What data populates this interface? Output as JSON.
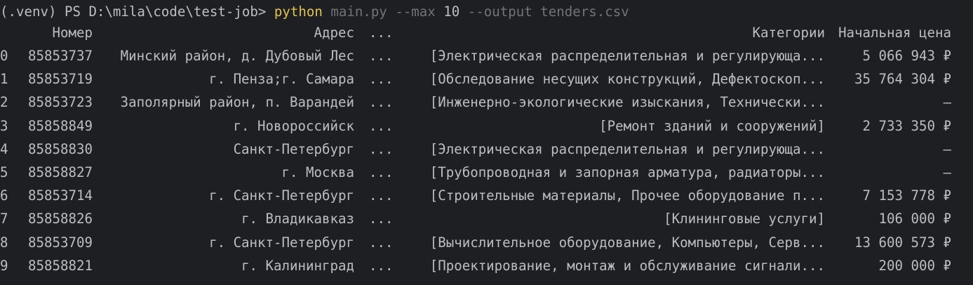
{
  "prompt": {
    "prefix": "(.venv) PS D:\\mila\\code\\test-job> ",
    "command": "python",
    "script": " main.py ",
    "flag_max": "--max",
    "max_value": " 10 ",
    "flag_output": "--output",
    "output_value": " tenders.csv"
  },
  "table": {
    "headers": {
      "number": "Номер",
      "address": "Адрес",
      "ellipsis": "...",
      "categories": "Категории",
      "price": "Начальная цена"
    },
    "rows": [
      {
        "idx": "0",
        "number": "85853737",
        "address": "Минский район, д. Дубовый Лес",
        "ellipsis": "...",
        "categories": "[Электрическая распределительная и регулирующа...",
        "price": "5 066 943 ₽"
      },
      {
        "idx": "1",
        "number": "85853719",
        "address": "г. Пенза;г. Самара",
        "ellipsis": "...",
        "categories": "[Обследование несущих конструкций, Дефектоскоп...",
        "price": "35 764 304 ₽"
      },
      {
        "idx": "2",
        "number": "85853723",
        "address": "Заполярный район, п. Варандей",
        "ellipsis": "...",
        "categories": "[Инженерно-экологические изыскания, Технически...",
        "price": "—"
      },
      {
        "idx": "3",
        "number": "85858849",
        "address": "г. Новороссийск",
        "ellipsis": "...",
        "categories": "[Ремонт зданий и сооружений]",
        "price": "2 733 350 ₽"
      },
      {
        "idx": "4",
        "number": "85858830",
        "address": "Санкт-Петербург",
        "ellipsis": "...",
        "categories": "[Электрическая распределительная и регулирующа...",
        "price": "—"
      },
      {
        "idx": "5",
        "number": "85858827",
        "address": "г. Москва",
        "ellipsis": "...",
        "categories": "[Трубопроводная и запорная арматура, радиаторы...",
        "price": "—"
      },
      {
        "idx": "6",
        "number": "85853714",
        "address": "г. Санкт-Петербург",
        "ellipsis": "...",
        "categories": "[Строительные материалы, Прочее оборудование п...",
        "price": "7 153 778 ₽"
      },
      {
        "idx": "7",
        "number": "85858826",
        "address": "г. Владикавказ",
        "ellipsis": "...",
        "categories": "[Клининговые услуги]",
        "price": "106 000 ₽"
      },
      {
        "idx": "8",
        "number": "85853709",
        "address": "г. Санкт-Петербург",
        "ellipsis": "...",
        "categories": "[Вычислительное оборудование, Компьютеры, Серв...",
        "price": "13 600 573 ₽"
      },
      {
        "idx": "9",
        "number": "85858821",
        "address": "г. Калининград",
        "ellipsis": "...",
        "categories": "[Проектирование, монтаж и обслуживание сигнали...",
        "price": "200 000 ₽"
      }
    ]
  },
  "colors": {
    "background": "#1e1f22",
    "text": "#bcbec4",
    "command": "#e0c34d",
    "flag": "#6f737a"
  }
}
